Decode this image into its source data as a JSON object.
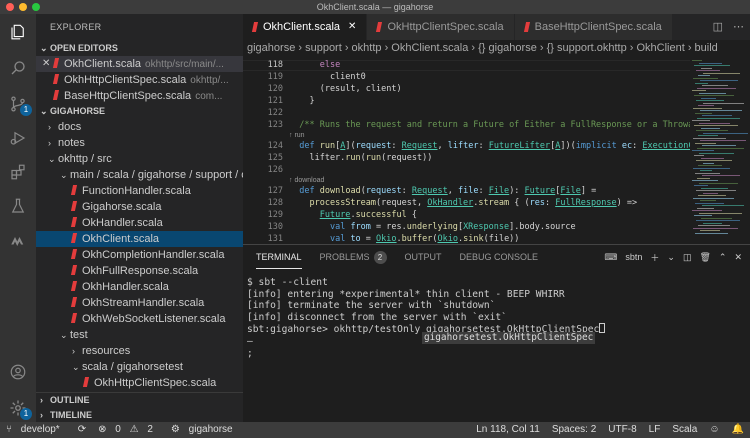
{
  "window": {
    "title": "OkhClient.scala — gigahorse"
  },
  "sidebar": {
    "title": "EXPLORER",
    "open_editors_label": "OPEN EDITORS",
    "open_editors": [
      {
        "name": "OkhClient.scala",
        "path": "okhttp/src/main/..."
      },
      {
        "name": "OkhHttpClientSpec.scala",
        "path": "okhttp/..."
      },
      {
        "name": "BaseHttpClientSpec.scala",
        "path": "com..."
      }
    ],
    "project_label": "GIGAHORSE",
    "tree": [
      {
        "label": "docs",
        "depth": 1,
        "kind": "folder-closed"
      },
      {
        "label": "notes",
        "depth": 1,
        "kind": "folder-closed"
      },
      {
        "label": "okhttp / src",
        "depth": 1,
        "kind": "folder-open"
      },
      {
        "label": "main / scala / gigahorse / support / ok...",
        "depth": 2,
        "kind": "folder-open"
      },
      {
        "label": "FunctionHandler.scala",
        "depth": 3,
        "kind": "file"
      },
      {
        "label": "Gigahorse.scala",
        "depth": 3,
        "kind": "file"
      },
      {
        "label": "OkHandler.scala",
        "depth": 3,
        "kind": "file"
      },
      {
        "label": "OkhClient.scala",
        "depth": 3,
        "kind": "file",
        "selected": true
      },
      {
        "label": "OkhCompletionHandler.scala",
        "depth": 3,
        "kind": "file"
      },
      {
        "label": "OkhFullResponse.scala",
        "depth": 3,
        "kind": "file"
      },
      {
        "label": "OkhHandler.scala",
        "depth": 3,
        "kind": "file"
      },
      {
        "label": "OkhStreamHandler.scala",
        "depth": 3,
        "kind": "file"
      },
      {
        "label": "OkhWebSocketListener.scala",
        "depth": 3,
        "kind": "file"
      },
      {
        "label": "test",
        "depth": 2,
        "kind": "folder-open"
      },
      {
        "label": "resources",
        "depth": 3,
        "kind": "folder-closed"
      },
      {
        "label": "scala / gigahorsetest",
        "depth": 3,
        "kind": "folder-open"
      },
      {
        "label": "OkhHttpClientSpec.scala",
        "depth": 4,
        "kind": "file"
      }
    ],
    "outline_label": "OUTLINE",
    "timeline_label": "TIMELINE"
  },
  "activity_bar": {
    "icons": [
      "files-icon",
      "search-icon",
      "source-control-icon",
      "run-debug-icon",
      "extensions-icon",
      "testing-icon",
      "metals-icon"
    ],
    "source_control_badge": "1",
    "account_icon": "account-icon",
    "settings_icon": "gear-icon",
    "settings_badge": "1"
  },
  "editor": {
    "tabs": [
      {
        "label": "OkhClient.scala",
        "active": true
      },
      {
        "label": "OkHttpClientSpec.scala",
        "active": false
      },
      {
        "label": "BaseHttpClientSpec.scala",
        "active": false
      }
    ],
    "breadcrumbs": "gigahorse › support › okhttp › OkhClient.scala › {} gigahorse › {} support.okhttp › OkhClient › build",
    "lines": [
      {
        "n": "118",
        "html": "      <span class='k'>else</span>"
      },
      {
        "n": "119",
        "html": "        client0"
      },
      {
        "n": "120",
        "html": "      (result, client)"
      },
      {
        "n": "121",
        "html": "    }"
      },
      {
        "n": "122",
        "html": ""
      },
      {
        "n": "123",
        "html": "  <span class='cm'>/** Runs the request and return a Future of Either a FullResponse or a Throwable. */</span>"
      },
      {
        "lens": "↑ run"
      },
      {
        "n": "124",
        "html": "  <span class='kw'>def</span> <span class='fn'>run</span>[<span class='ty ul'>A</span>](<span class='pa'>request</span>: <span class='ty ul'>Request</span>, <span class='pa'>lifter</span>: <span class='ty ul'>FutureLifter</span>[<span class='ty ul'>A</span>])(<span class='kw'>implicit</span> <span class='pa'>ec</span>: <span class='ty ul'>ExecutionContext</span>): <span class='ty ul'>Futur</span>"
      },
      {
        "n": "125",
        "html": "    lifter.<span class='fn'>run</span>(<span class='fn'>run</span>(request))"
      },
      {
        "n": "126",
        "html": ""
      },
      {
        "lens": "↑ download"
      },
      {
        "n": "127",
        "html": "  <span class='kw'>def</span> <span class='fn'>download</span>(<span class='pa'>request</span>: <span class='ty ul'>Request</span>, <span class='pa'>file</span>: <span class='ty ul'>File</span>): <span class='ty ul'>Future</span>[<span class='ty ul'>File</span>] ="
      },
      {
        "n": "128",
        "html": "    <span class='fn'>processStream</span>(request, <span class='ty ul'>OkHandler</span>.<span class='fn'>stream</span> { (<span class='pa'>res</span>: <span class='ty ul'>FullResponse</span>) =>"
      },
      {
        "n": "129",
        "html": "      <span class='ty ul'>Future</span>.<span class='fn'>successful</span> {"
      },
      {
        "n": "130",
        "html": "        <span class='kw'>val</span> <span class='pa'>from</span> = res.<span class='fn'>underlying</span>[<span class='ty'>XResponse</span>].body.source"
      },
      {
        "n": "131",
        "html": "        <span class='kw'>val</span> <span class='pa'>to</span> = <span class='ty ul'>Okio</span>.<span class='fn'>buffer</span>(<span class='ty ul'>Okio</span>.<span class='fn'>sink</span>(file))"
      },
      {
        "n": "132",
        "html": "        <span class='k'>try</span> {"
      }
    ],
    "current_line": "118"
  },
  "panel": {
    "tabs": [
      {
        "label": "TERMINAL",
        "active": true
      },
      {
        "label": "PROBLEMS",
        "badge": "2"
      },
      {
        "label": "OUTPUT"
      },
      {
        "label": "DEBUG CONSOLE"
      }
    ],
    "terminal_name": "sbtn",
    "terminal_lines": [
      "$ sbt --client",
      "[info] entering *experimental* thin client - BEEP WHIRR",
      "[info] terminate the server with `shutdown`",
      "[info] disconnect from the server with `exit`",
      "sbt:gigahorse> okhttp/testOnly gigahorsetest.OkHttpClientSpec",
      "—",
      ";"
    ],
    "completion": "gigahorsetest.OkHttpClientSpec"
  },
  "status_bar": {
    "branch": "develop*",
    "errors": "0",
    "warnings": "2",
    "project": "gigahorse",
    "position": "Ln 118, Col 11",
    "spaces": "Spaces: 2",
    "encoding": "UTF-8",
    "eol": "LF",
    "language": "Scala"
  },
  "colors": {
    "accent": "#0e639c",
    "scala_red": "#e33c3c",
    "activity_bg": "#333333",
    "sidebar_bg": "#252526",
    "editor_bg": "#1e1e1e"
  }
}
